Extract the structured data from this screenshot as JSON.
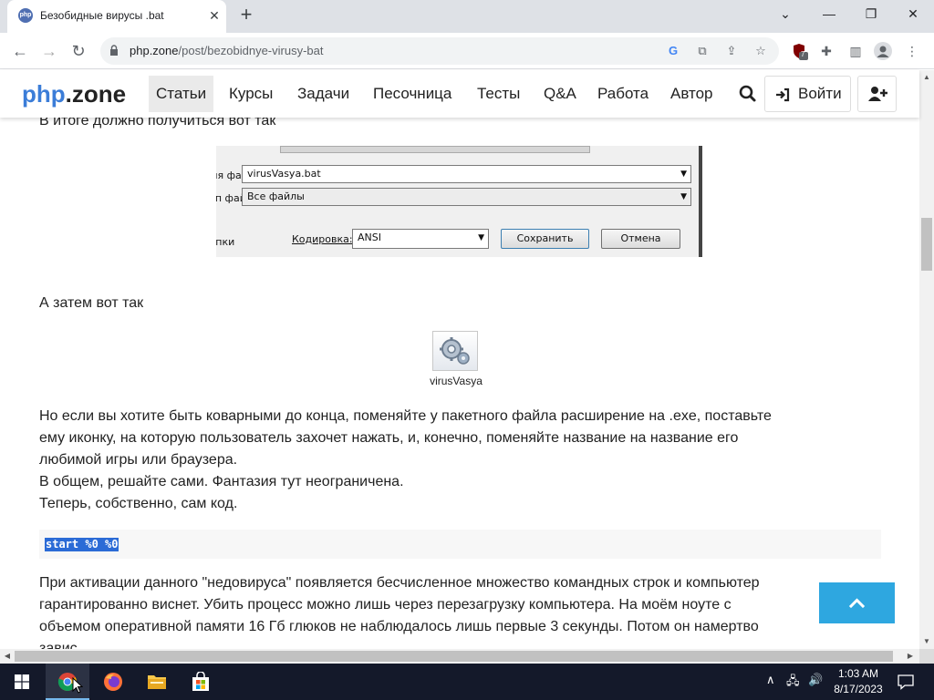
{
  "browser": {
    "tab_title": "Безобидные вирусы .bat",
    "tab_favicon_text": "php",
    "url_host": "php.zone",
    "url_path": "/post/bezobidnye-virusy-bat",
    "ext_badge": "7"
  },
  "site": {
    "logo_php": "php",
    "logo_zone": ".zone",
    "nav": [
      "Статьи",
      "Курсы",
      "Задачи",
      "Песочница",
      "Тесты",
      "Q&A",
      "Работа",
      "Автор"
    ],
    "active_nav": "Статьи",
    "login_label": "Войти"
  },
  "article": {
    "p_result": "В итоге должно получиться вот так",
    "save_dialog": {
      "filename_label": "Имя файла:",
      "filename_value": "virusVasya.bat",
      "filetype_label": "Тип файла:",
      "filetype_value": "Все файлы",
      "hide_folders": "Скрыть папки",
      "encoding_label": "Кодировка:",
      "encoding_value": "ANSI",
      "save_button": "Сохранить",
      "cancel_button": "Отмена"
    },
    "p_then": "А затем вот так",
    "file_caption": "virusVasya",
    "p_sneaky_1": "Но если вы хотите быть коварными до конца, поменяйте у пакетного файла расширение на .exe, поставьте",
    "p_sneaky_2": "ему иконку, на которую пользователь захочет нажать, и, конечно, поменяйте название на название его",
    "p_sneaky_3": "любимой игры или браузера.",
    "p_decide": "В общем, решайте сами. Фантазия тут неограничена.",
    "p_code_intro": "Теперь, собственно, сам код.",
    "code": "start %0 %0",
    "p_after_1": "При активации данного \"недовируса\" появляется бесчисленное множество командных строк и компьютер",
    "p_after_2": "гарантированно виснет. Убить процесс можно лишь через перезагрузку компьютера. На моём ноуте с",
    "p_after_3": "объемом оперативной памяти 16 Гб глюков не наблюдалось лишь первые 3 секунды. Потом он намертво",
    "p_after_4": "завис."
  },
  "taskbar": {
    "time": "1:03 AM",
    "date": "8/17/2023"
  }
}
